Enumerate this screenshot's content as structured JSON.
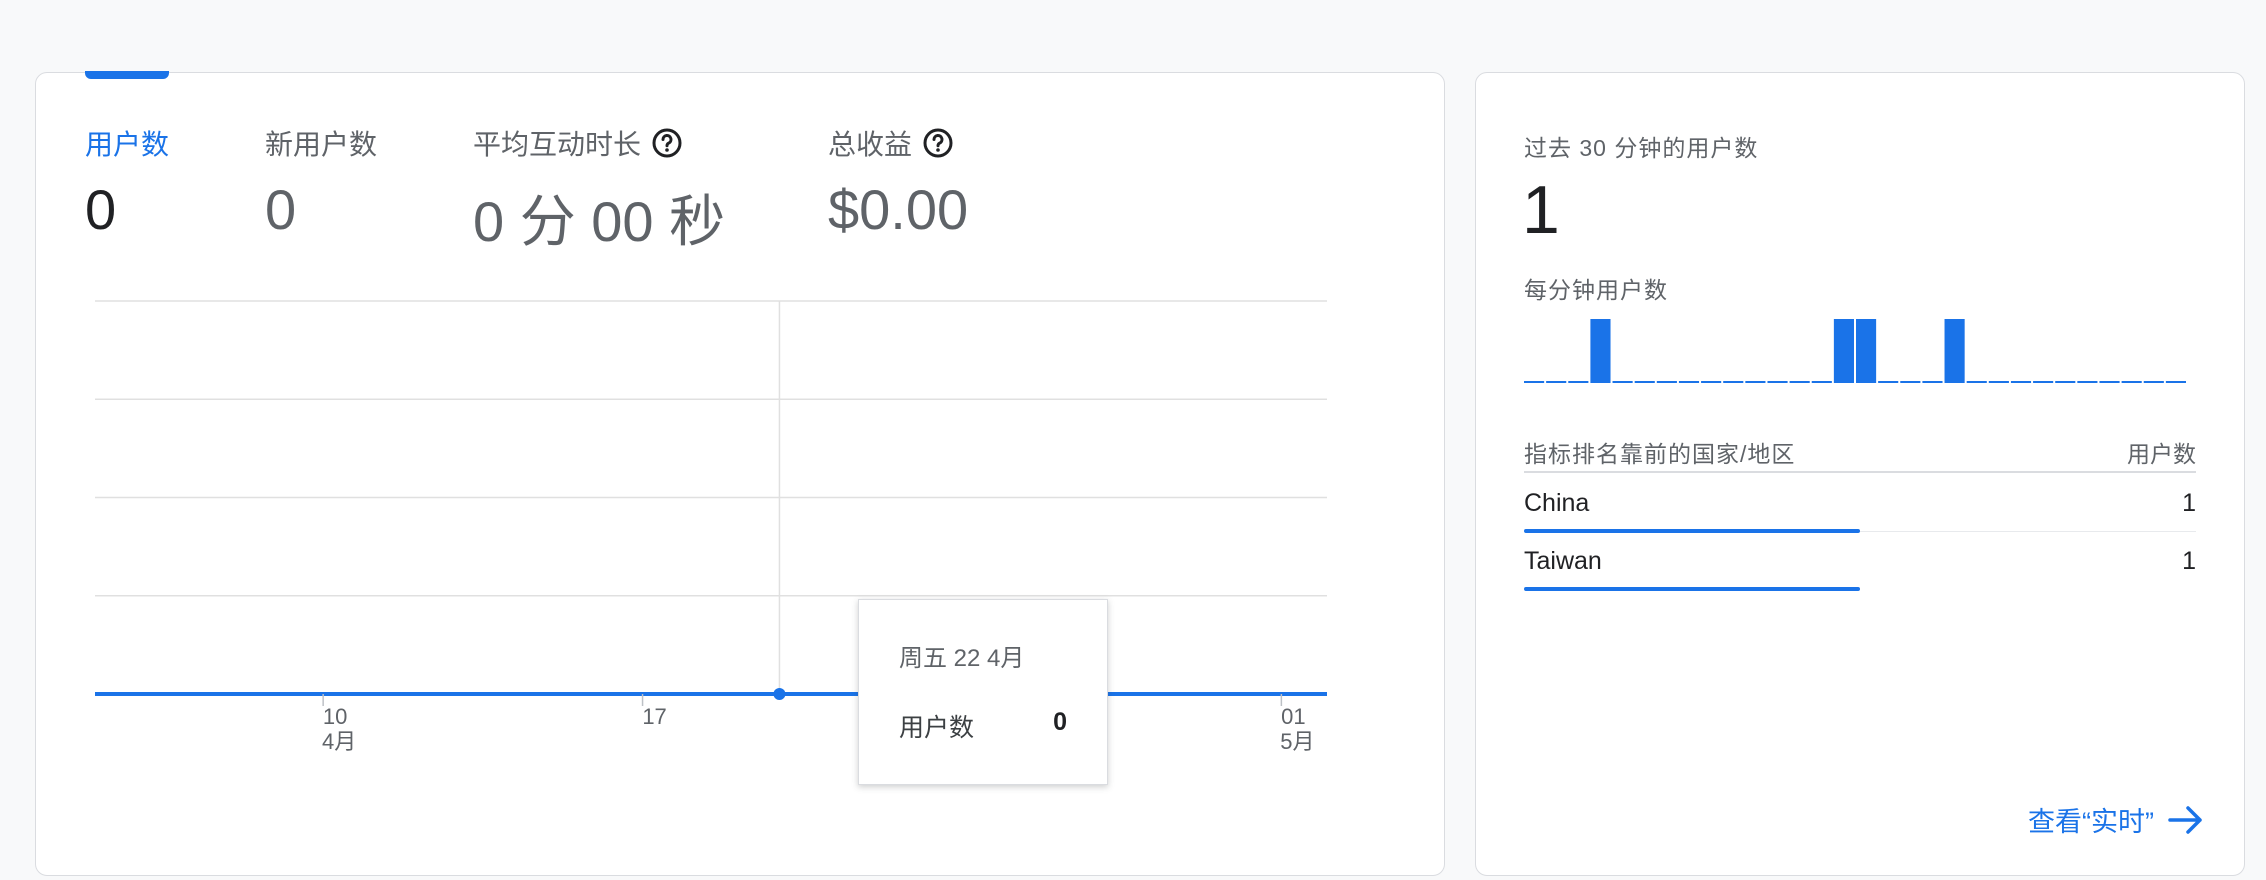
{
  "overview": {
    "metrics": [
      {
        "label": "用户数",
        "value": "0",
        "active": true
      },
      {
        "label": "新用户数",
        "value": "0",
        "active": false
      },
      {
        "label": "平均互动时长",
        "value": "0 分 00 秒",
        "active": false,
        "help": true
      },
      {
        "label": "总收益",
        "value": "$0.00",
        "active": false,
        "help": true
      }
    ],
    "tooltip": {
      "date": "周五 22 4月",
      "metric": "用户数",
      "value": "0"
    }
  },
  "chart_data": {
    "type": "line",
    "series": [
      {
        "values": [
          0,
          0,
          0,
          0,
          0,
          0,
          0,
          0,
          0,
          0,
          0,
          0,
          0,
          0,
          0,
          0,
          0,
          0,
          0,
          0,
          0,
          0,
          0,
          0,
          0,
          0,
          0,
          0
        ]
      }
    ],
    "x_ticks": [
      {
        "day": "10",
        "month": "4月"
      },
      {
        "day": "17",
        "month": ""
      },
      {
        "day": "01",
        "month": "5月"
      }
    ],
    "highlight_label": "周五 22 4月",
    "ylim": [
      0,
      4
    ],
    "grid": true
  },
  "realtime": {
    "title": "过去 30 分钟的用户数",
    "count": "1",
    "per_minute_label": "每分钟用户数",
    "per_minute": [
      0,
      0,
      0,
      1,
      0,
      0,
      0,
      0,
      0,
      0,
      0,
      0,
      0,
      0,
      1,
      1,
      0,
      0,
      0,
      1,
      0,
      0,
      0,
      0,
      0,
      0,
      0,
      0,
      0,
      0
    ],
    "table_header": {
      "left": "指标排名靠前的国家/地区",
      "right": "用户数"
    },
    "rows": [
      {
        "name": "China",
        "value": "1",
        "share": 0.5
      },
      {
        "name": "Taiwan",
        "value": "1",
        "share": 0.5
      }
    ],
    "link_label": "查看“实时”"
  },
  "colors": {
    "accent": "#1a73e8",
    "grid": "#e0e0e0",
    "text_secondary": "#5f6368"
  }
}
